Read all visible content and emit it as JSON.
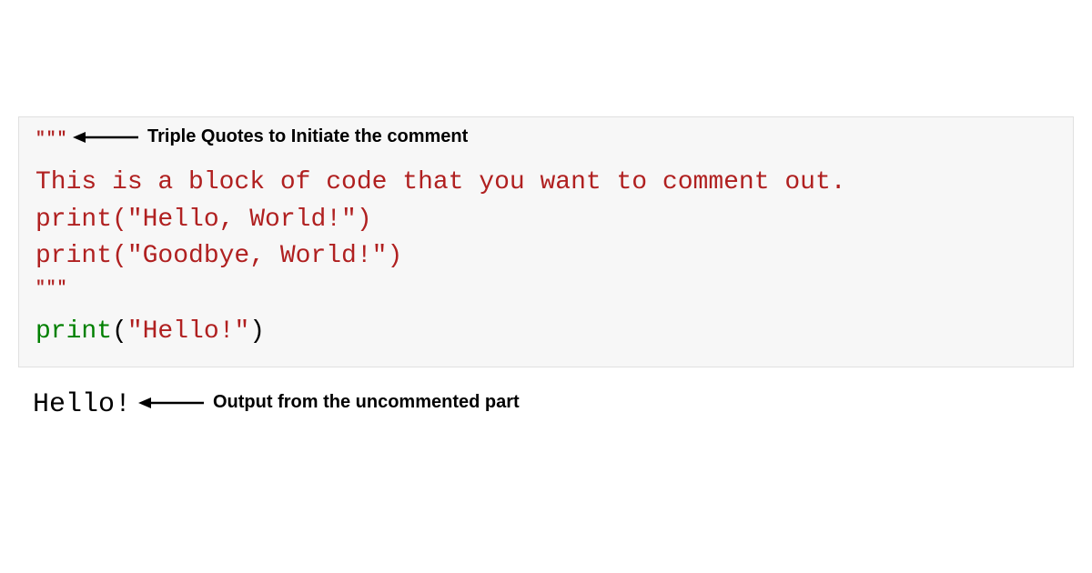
{
  "code": {
    "triple_quote_open": "\"\"\"",
    "comment_line": "This is a block of code that you want to comment out.",
    "print_hello_world": "print(\"Hello, World!\")",
    "print_goodbye_world": "print(\"Goodbye, World!\")",
    "triple_quote_close": "\"\"\"",
    "active_print_func": "print",
    "active_print_open": "(",
    "active_print_string": "\"Hello!\"",
    "active_print_close": ")"
  },
  "output": {
    "text": "Hello!"
  },
  "annotations": {
    "top_label": "Triple Quotes to Initiate the comment",
    "bottom_label": "Output from the uncommented part"
  }
}
